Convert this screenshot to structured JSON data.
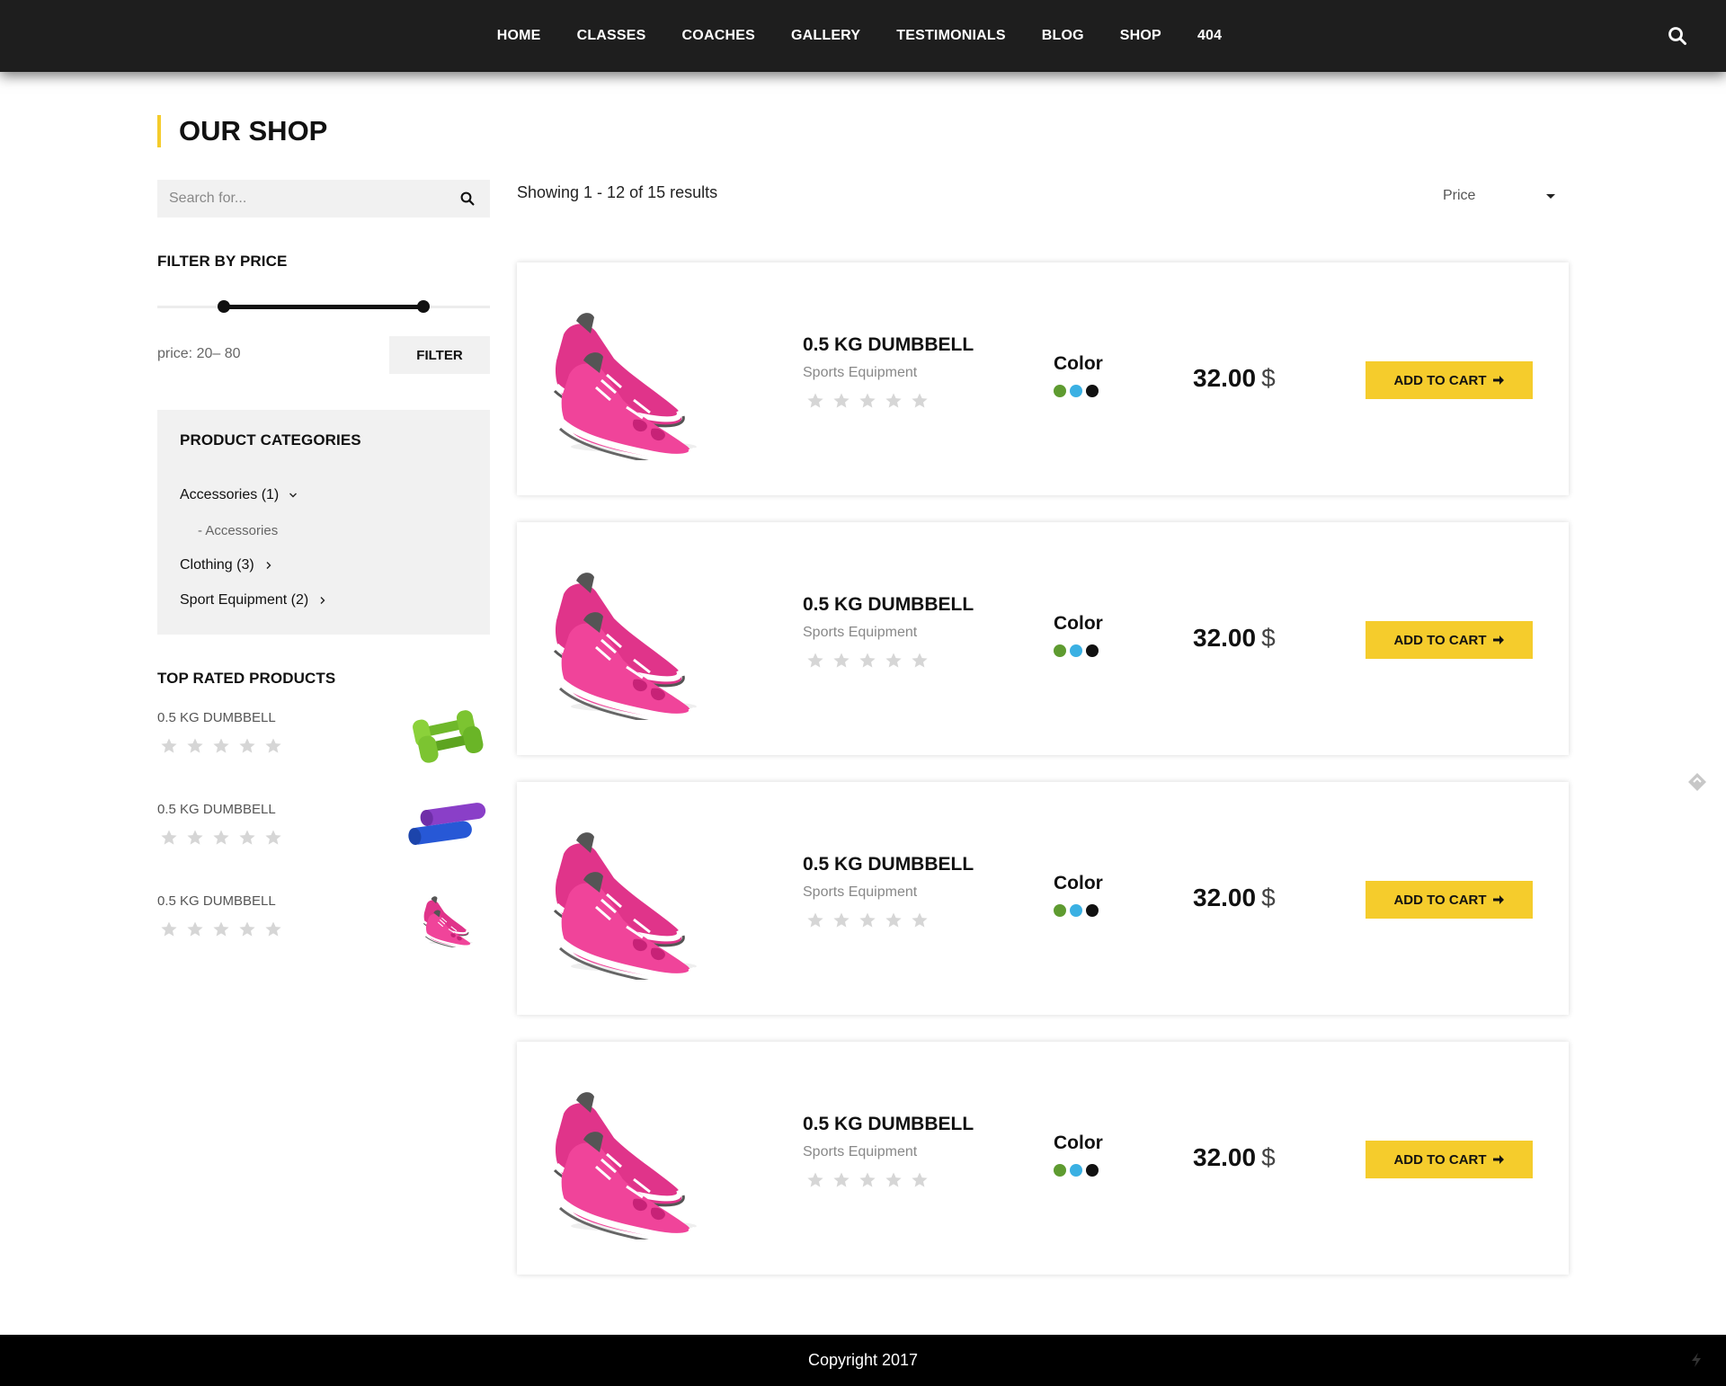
{
  "nav": {
    "items": [
      "HOME",
      "CLASSES",
      "COACHES",
      "GALLERY",
      "TESTIMONIALS",
      "BLOG",
      "SHOP",
      "404"
    ],
    "search_icon": "search-icon"
  },
  "page_title": "OUR SHOP",
  "sidebar": {
    "search_placeholder": "Search for...",
    "filter_heading": "FILTER BY PRICE",
    "price_min": 20,
    "price_max": 80,
    "price_range_text": "price: 20– 80",
    "filter_button": "FILTER",
    "categories_heading": "PRODUCT CATEGORIES",
    "categories": [
      {
        "label": "Accessories (1)",
        "icon": "chevron-down-icon"
      },
      {
        "label": "- Accessories"
      },
      {
        "label": "Clothing (3)",
        "icon": "chevron-right-icon"
      },
      {
        "label": "Sport Equipment (2)",
        "icon": "chevron-right-icon"
      }
    ],
    "top_rated_heading": "TOP RATED PRODUCTS",
    "top_rated": [
      {
        "name": "0.5 KG DUMBBELL",
        "image": "green-dumbbells"
      },
      {
        "name": "0.5 KG DUMBBELL",
        "image": "yoga-mats"
      },
      {
        "name": "0.5 KG DUMBBELL",
        "image": "pink-sneakers"
      }
    ]
  },
  "main": {
    "results_text": "Showing 1 - 12 of 15 results",
    "sort_label": "Price",
    "products": [
      {
        "name": "0.5 KG DUMBBELL",
        "category": "Sports Equipment",
        "color_label": "Color",
        "price": "32.00",
        "currency": "$",
        "button": "ADD TO CART",
        "rating": 0
      },
      {
        "name": "0.5 KG DUMBBELL",
        "category": "Sports Equipment",
        "color_label": "Color",
        "price": "32.00",
        "currency": "$",
        "button": "ADD TO CART",
        "rating": 0
      },
      {
        "name": "0.5 KG DUMBBELL",
        "category": "Sports Equipment",
        "color_label": "Color",
        "price": "32.00",
        "currency": "$",
        "button": "ADD TO CART",
        "rating": 0
      },
      {
        "name": "0.5 KG DUMBBELL",
        "category": "Sports Equipment",
        "color_label": "Color",
        "price": "32.00",
        "currency": "$",
        "button": "ADD TO CART",
        "rating": 0
      }
    ],
    "color_swatches": [
      "#5e9b30",
      "#3ab0e3",
      "#111111"
    ]
  },
  "colors": {
    "accent": "#f5cc2c",
    "nav_bg": "#1e1e1e",
    "footer_bg": "#000000",
    "panel_bg": "#f1f1f1"
  },
  "footer": {
    "copyright": "Copyright 2017"
  }
}
